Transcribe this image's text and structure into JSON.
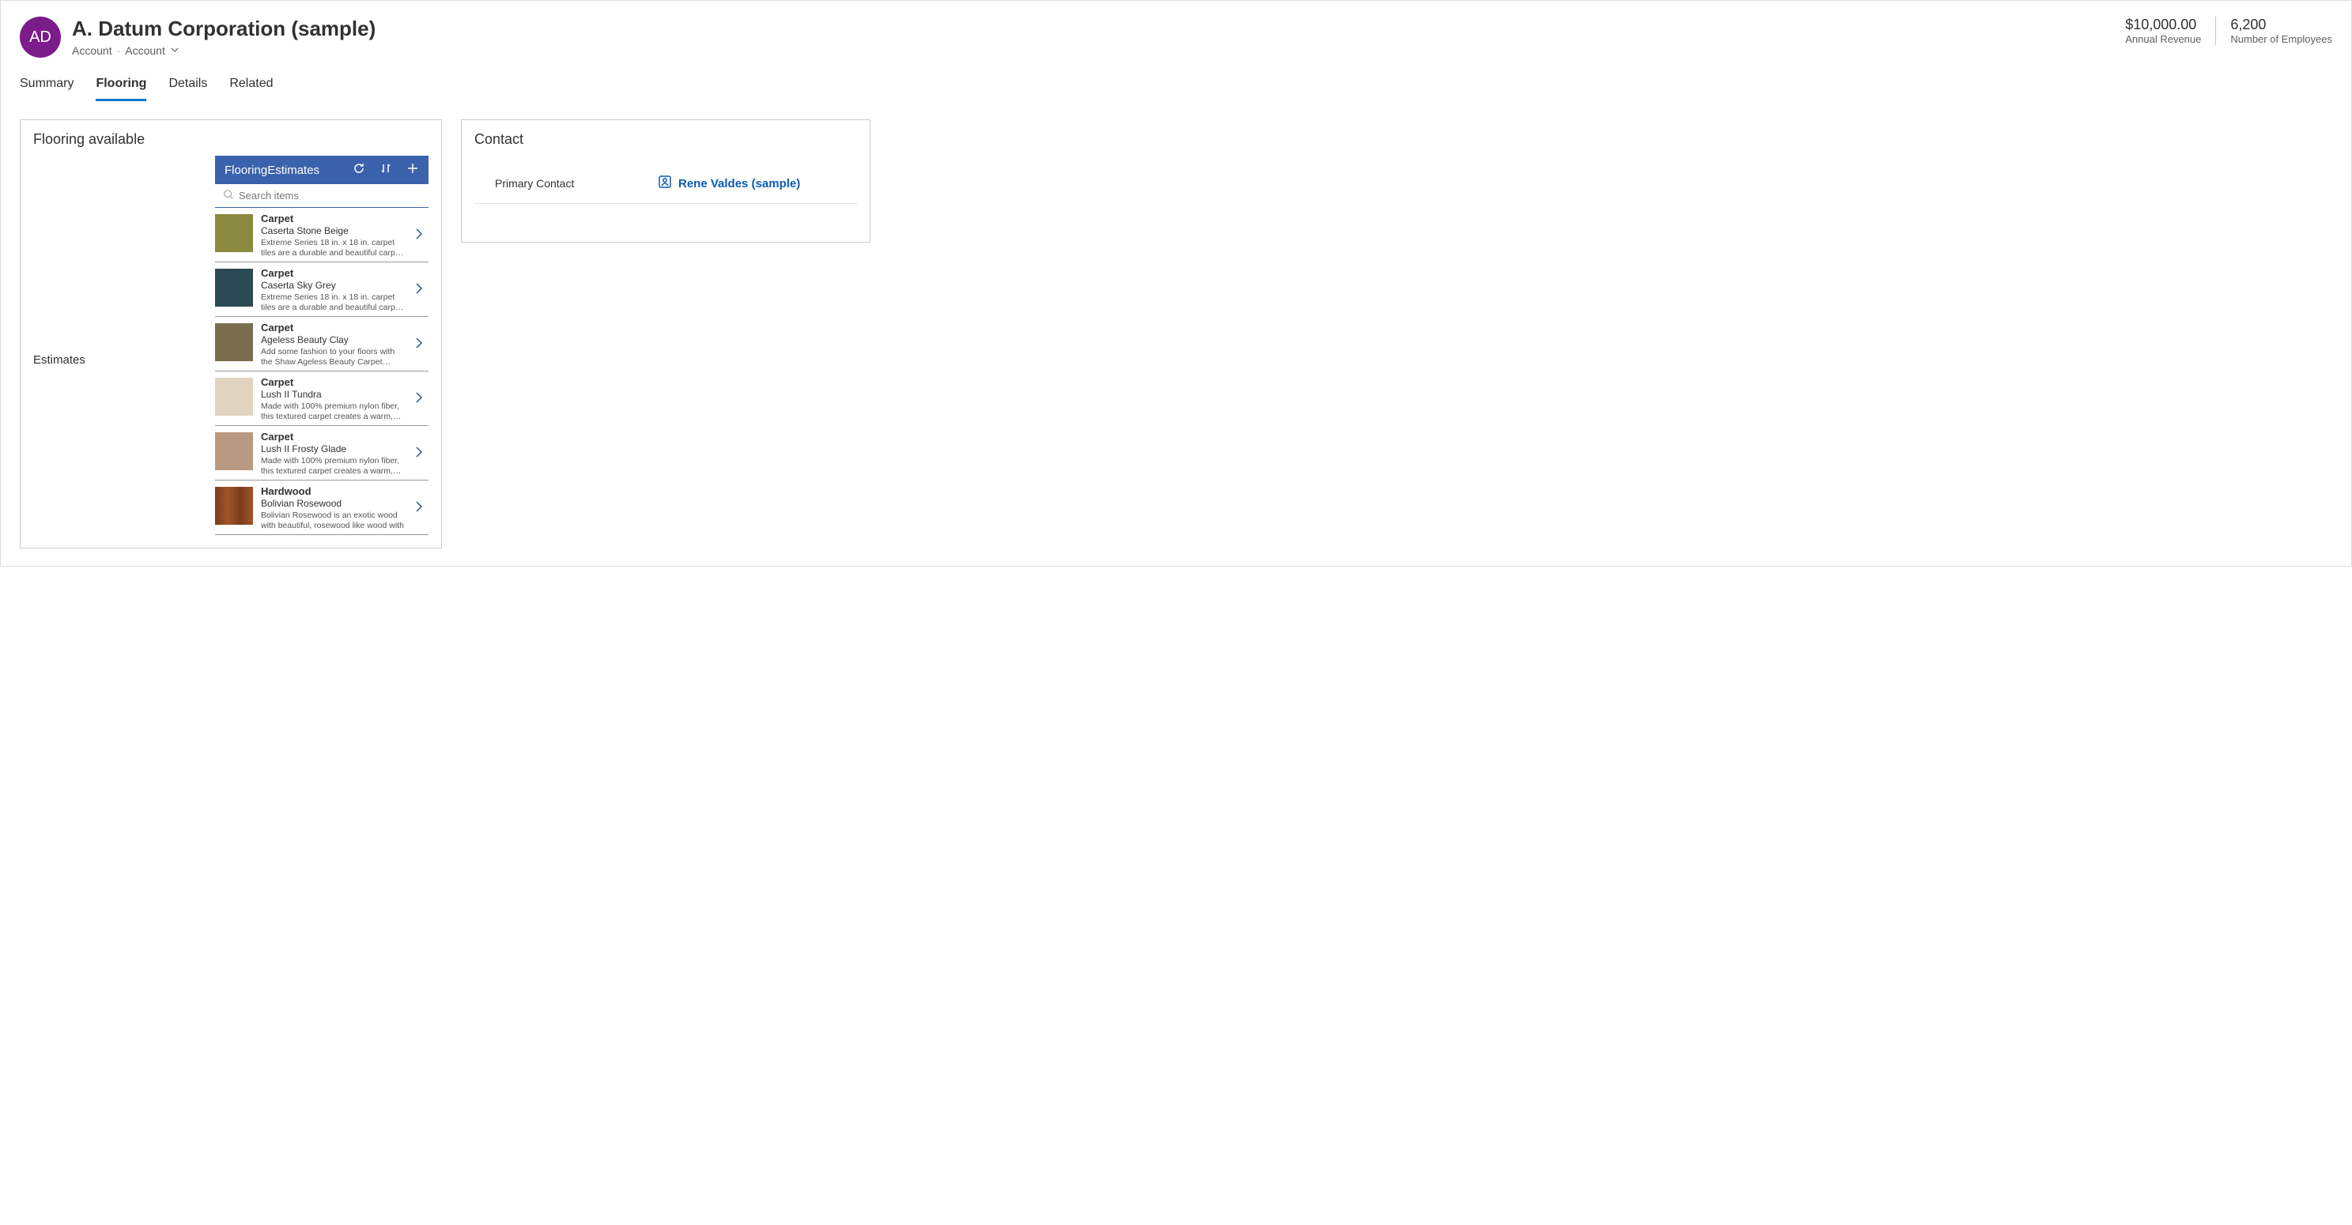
{
  "header": {
    "avatar_initials": "AD",
    "title": "A. Datum Corporation (sample)",
    "breadcrumb_entity": "Account",
    "breadcrumb_form": "Account"
  },
  "metrics": [
    {
      "value": "$10,000.00",
      "label": "Annual Revenue"
    },
    {
      "value": "6,200",
      "label": "Number of Employees"
    }
  ],
  "tabs": [
    "Summary",
    "Flooring",
    "Details",
    "Related"
  ],
  "active_tab": "Flooring",
  "flooring_panel": {
    "title": "Flooring available",
    "side_label": "Estimates",
    "app_title": "FlooringEstimates",
    "search_placeholder": "Search items",
    "items": [
      {
        "category": "Carpet",
        "name": "Caserta Stone Beige",
        "desc": "Extreme Series 18 in. x 18 in. carpet tiles are a durable and beautiful carpet solution specially engineered for both",
        "swatch": "beige"
      },
      {
        "category": "Carpet",
        "name": "Caserta Sky Grey",
        "desc": "Extreme Series 18 in. x 18 in. carpet tiles are a durable and beautiful carpet solution specially engineered for both",
        "swatch": "grey"
      },
      {
        "category": "Carpet",
        "name": "Ageless Beauty Clay",
        "desc": "Add some fashion to your floors with the Shaw Ageless Beauty Carpet collection.",
        "swatch": "clay"
      },
      {
        "category": "Carpet",
        "name": "Lush II Tundra",
        "desc": "Made with 100% premium nylon fiber, this textured carpet creates a warm, casual atmosphere that invites you to",
        "swatch": "tundra"
      },
      {
        "category": "Carpet",
        "name": "Lush II Frosty Glade",
        "desc": "Made with 100% premium nylon fiber, this textured carpet creates a warm, casual atmosphere that invites you to",
        "swatch": "frosty"
      },
      {
        "category": "Hardwood",
        "name": "Bolivian Rosewood",
        "desc": "Bolivian Rosewood is an exotic wood with beautiful, rosewood like wood with",
        "swatch": "rosewood"
      }
    ]
  },
  "contact_panel": {
    "title": "Contact",
    "field_label": "Primary Contact",
    "field_value": "Rene Valdes (sample)"
  }
}
